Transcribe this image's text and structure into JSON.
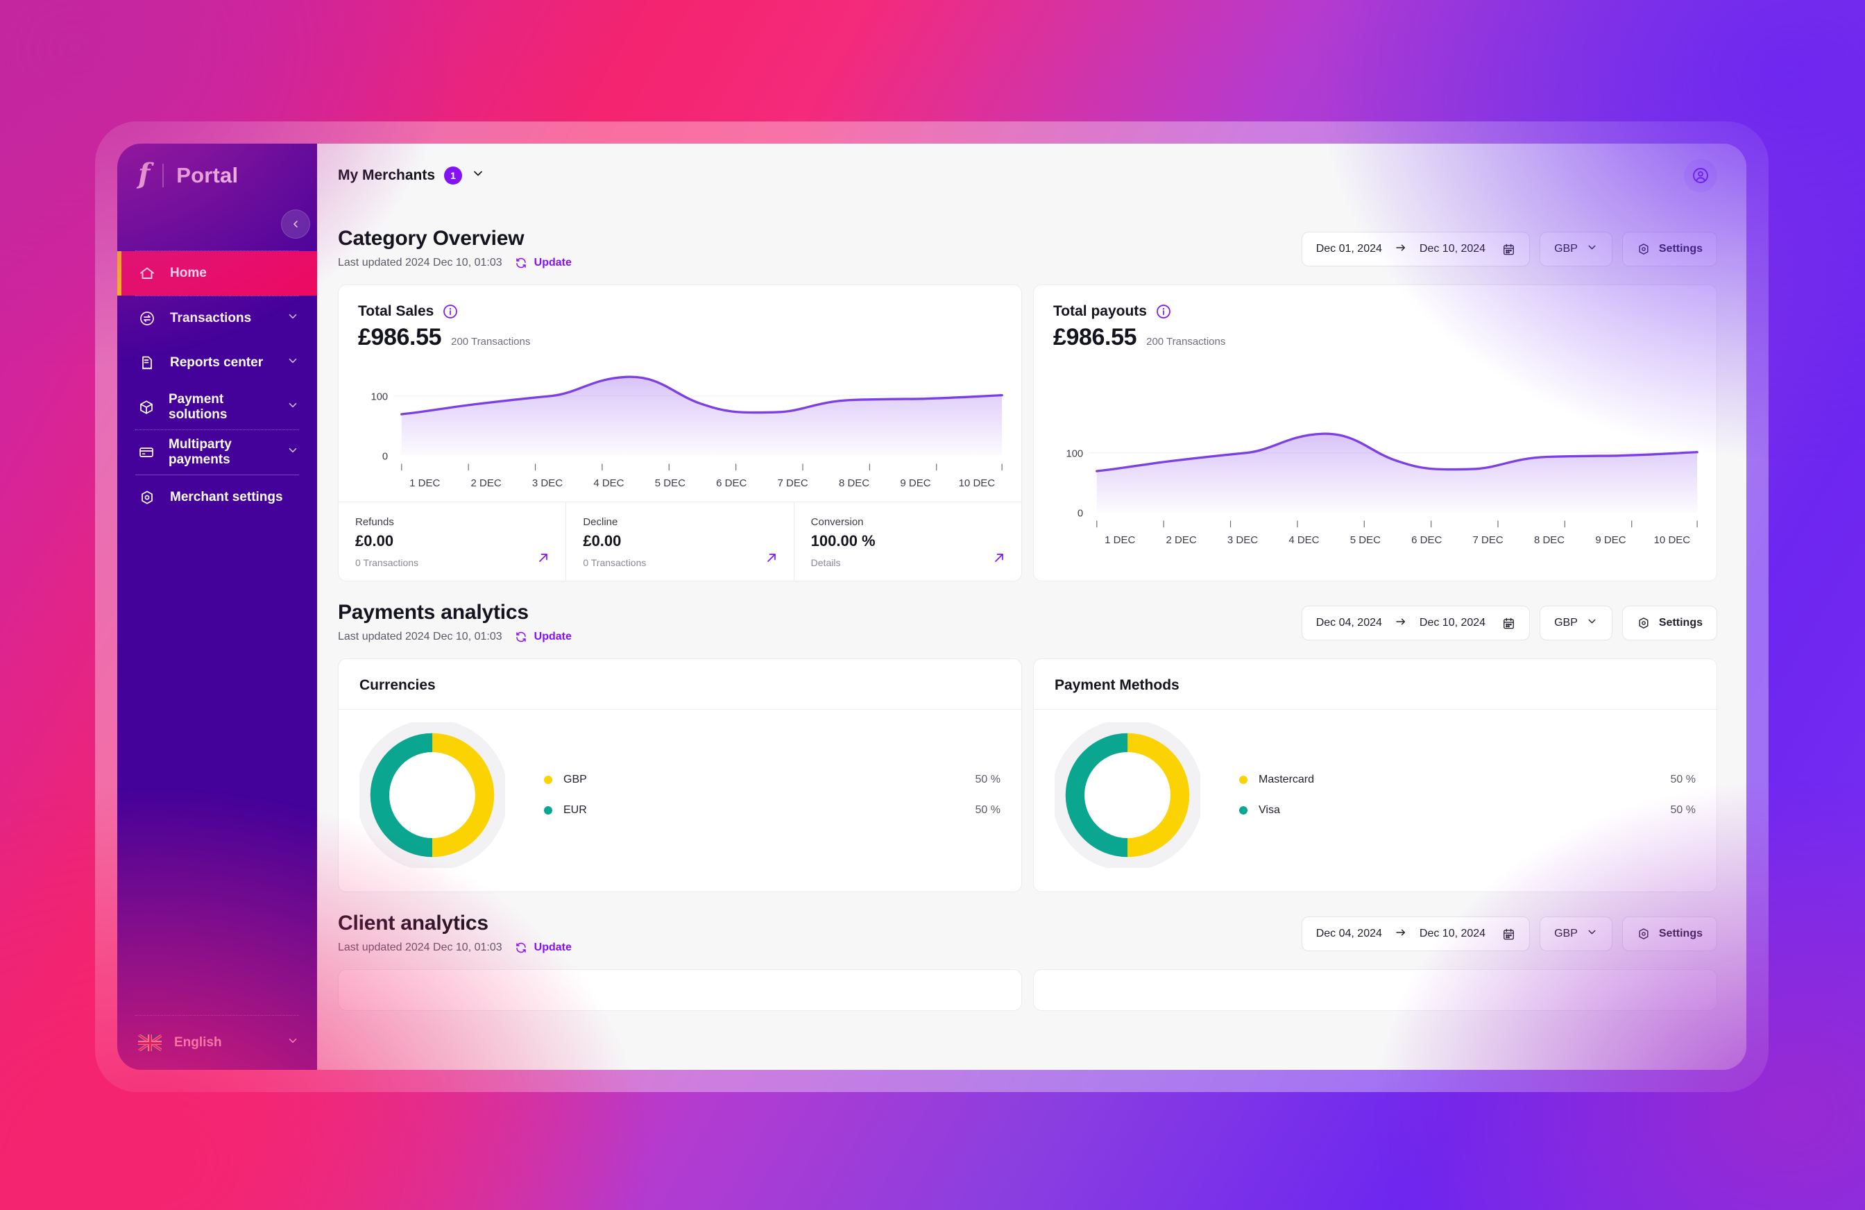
{
  "theme": {
    "sidebar_bg": "#44029a",
    "active_item_bg": "#ed0a62",
    "active_item_marker": "#ffd400",
    "accent_purple": "#8312f5",
    "donut_yellow": "#fbd303",
    "donut_teal": "#0aa68f",
    "line_purple": "#7b3fe4",
    "page_bg": "#f7f7f8"
  },
  "sidebar": {
    "logo_glyph": "f",
    "title": "Portal",
    "collapse_icon": "chevron-left-icon",
    "items": [
      {
        "label": "Home",
        "icon": "home-icon",
        "active": true,
        "expandable": false
      },
      {
        "label": "Transactions",
        "icon": "transactions-icon",
        "active": false,
        "expandable": true
      },
      {
        "label": "Reports center",
        "icon": "report-icon",
        "active": false,
        "expandable": true
      },
      {
        "label": "Payment solutions",
        "icon": "box-icon",
        "active": false,
        "expandable": true
      },
      {
        "label": "Multiparty payments",
        "icon": "card-icon",
        "active": false,
        "expandable": true
      },
      {
        "label": "Merchant settings",
        "icon": "gear-hex-icon",
        "active": false,
        "expandable": false
      }
    ],
    "language": {
      "label": "English",
      "flag": "uk-flag-icon",
      "chevron": "chevron-down-icon"
    }
  },
  "topbar": {
    "merchants_label": "My Merchants",
    "merchants_count": "1",
    "chevron": "chevron-down-icon",
    "avatar_icon": "user-circle-icon"
  },
  "sections": {
    "category_overview": {
      "title": "Category Overview",
      "last_updated": "Last updated 2024 Dec 10, 01:03",
      "update_label": "Update",
      "date_from": "Dec 01, 2024",
      "date_to": "Dec 10, 2024",
      "currency": "GBP",
      "settings_label": "Settings"
    },
    "payments_analytics": {
      "title": "Payments analytics",
      "last_updated": "Last updated 2024 Dec 10, 01:03",
      "update_label": "Update",
      "date_from": "Dec 04, 2024",
      "date_to": "Dec 10, 2024",
      "currency": "GBP",
      "settings_label": "Settings"
    },
    "client_analytics": {
      "title": "Client analytics",
      "last_updated": "Last updated 2024 Dec 10, 01:03",
      "update_label": "Update",
      "date_from": "Dec 04, 2024",
      "date_to": "Dec 10, 2024",
      "currency": "GBP",
      "settings_label": "Settings"
    }
  },
  "total_sales": {
    "title": "Total Sales",
    "amount": "£986.55",
    "transactions": "200 Transactions",
    "stats": [
      {
        "label": "Refunds",
        "value": "£0.00",
        "foot": "0 Transactions"
      },
      {
        "label": "Decline",
        "value": "£0.00",
        "foot": "0 Transactions"
      },
      {
        "label": "Conversion",
        "value": "100.00 %",
        "foot": "Details"
      }
    ]
  },
  "total_payouts": {
    "title": "Total payouts",
    "amount": "£986.55",
    "transactions": "200 Transactions"
  },
  "currencies_card": {
    "title": "Currencies"
  },
  "payment_methods_card": {
    "title": "Payment Methods"
  },
  "chart_data": [
    {
      "type": "area",
      "title": "Total Sales",
      "xlabel": "",
      "ylabel": "",
      "grid": false,
      "ylim": [
        0,
        125
      ],
      "yticks": [
        0,
        100
      ],
      "ytick_labels": [
        "0",
        "100"
      ],
      "categories": [
        "1 DEC",
        "2 DEC",
        "3 DEC",
        "4 DEC",
        "5 DEC",
        "6 DEC",
        "7 DEC",
        "8 DEC",
        "9 DEC",
        "10 DEC"
      ],
      "values": [
        76,
        85,
        92,
        113,
        96,
        77,
        90,
        92,
        91,
        95
      ]
    },
    {
      "type": "area",
      "title": "Total payouts",
      "xlabel": "",
      "ylabel": "",
      "grid": false,
      "ylim": [
        0,
        125
      ],
      "yticks": [
        0,
        100
      ],
      "ytick_labels": [
        "0",
        "100"
      ],
      "categories": [
        "1 DEC",
        "2 DEC",
        "3 DEC",
        "4 DEC",
        "5 DEC",
        "6 DEC",
        "7 DEC",
        "8 DEC",
        "9 DEC",
        "10 DEC"
      ],
      "values": [
        76,
        85,
        92,
        113,
        96,
        77,
        90,
        92,
        91,
        95
      ]
    },
    {
      "type": "pie",
      "title": "Currencies",
      "legend_position": "right",
      "labels": [
        "GBP",
        "EUR"
      ],
      "values": [
        50,
        50
      ],
      "value_labels": [
        "50 %",
        "50 %"
      ],
      "colors": [
        "#fbd303",
        "#0aa68f"
      ]
    },
    {
      "type": "pie",
      "title": "Payment Methods",
      "legend_position": "right",
      "labels": [
        "Mastercard",
        "Visa"
      ],
      "values": [
        50,
        50
      ],
      "value_labels": [
        "50 %",
        "50 %"
      ],
      "colors": [
        "#fbd303",
        "#0aa68f"
      ]
    }
  ]
}
